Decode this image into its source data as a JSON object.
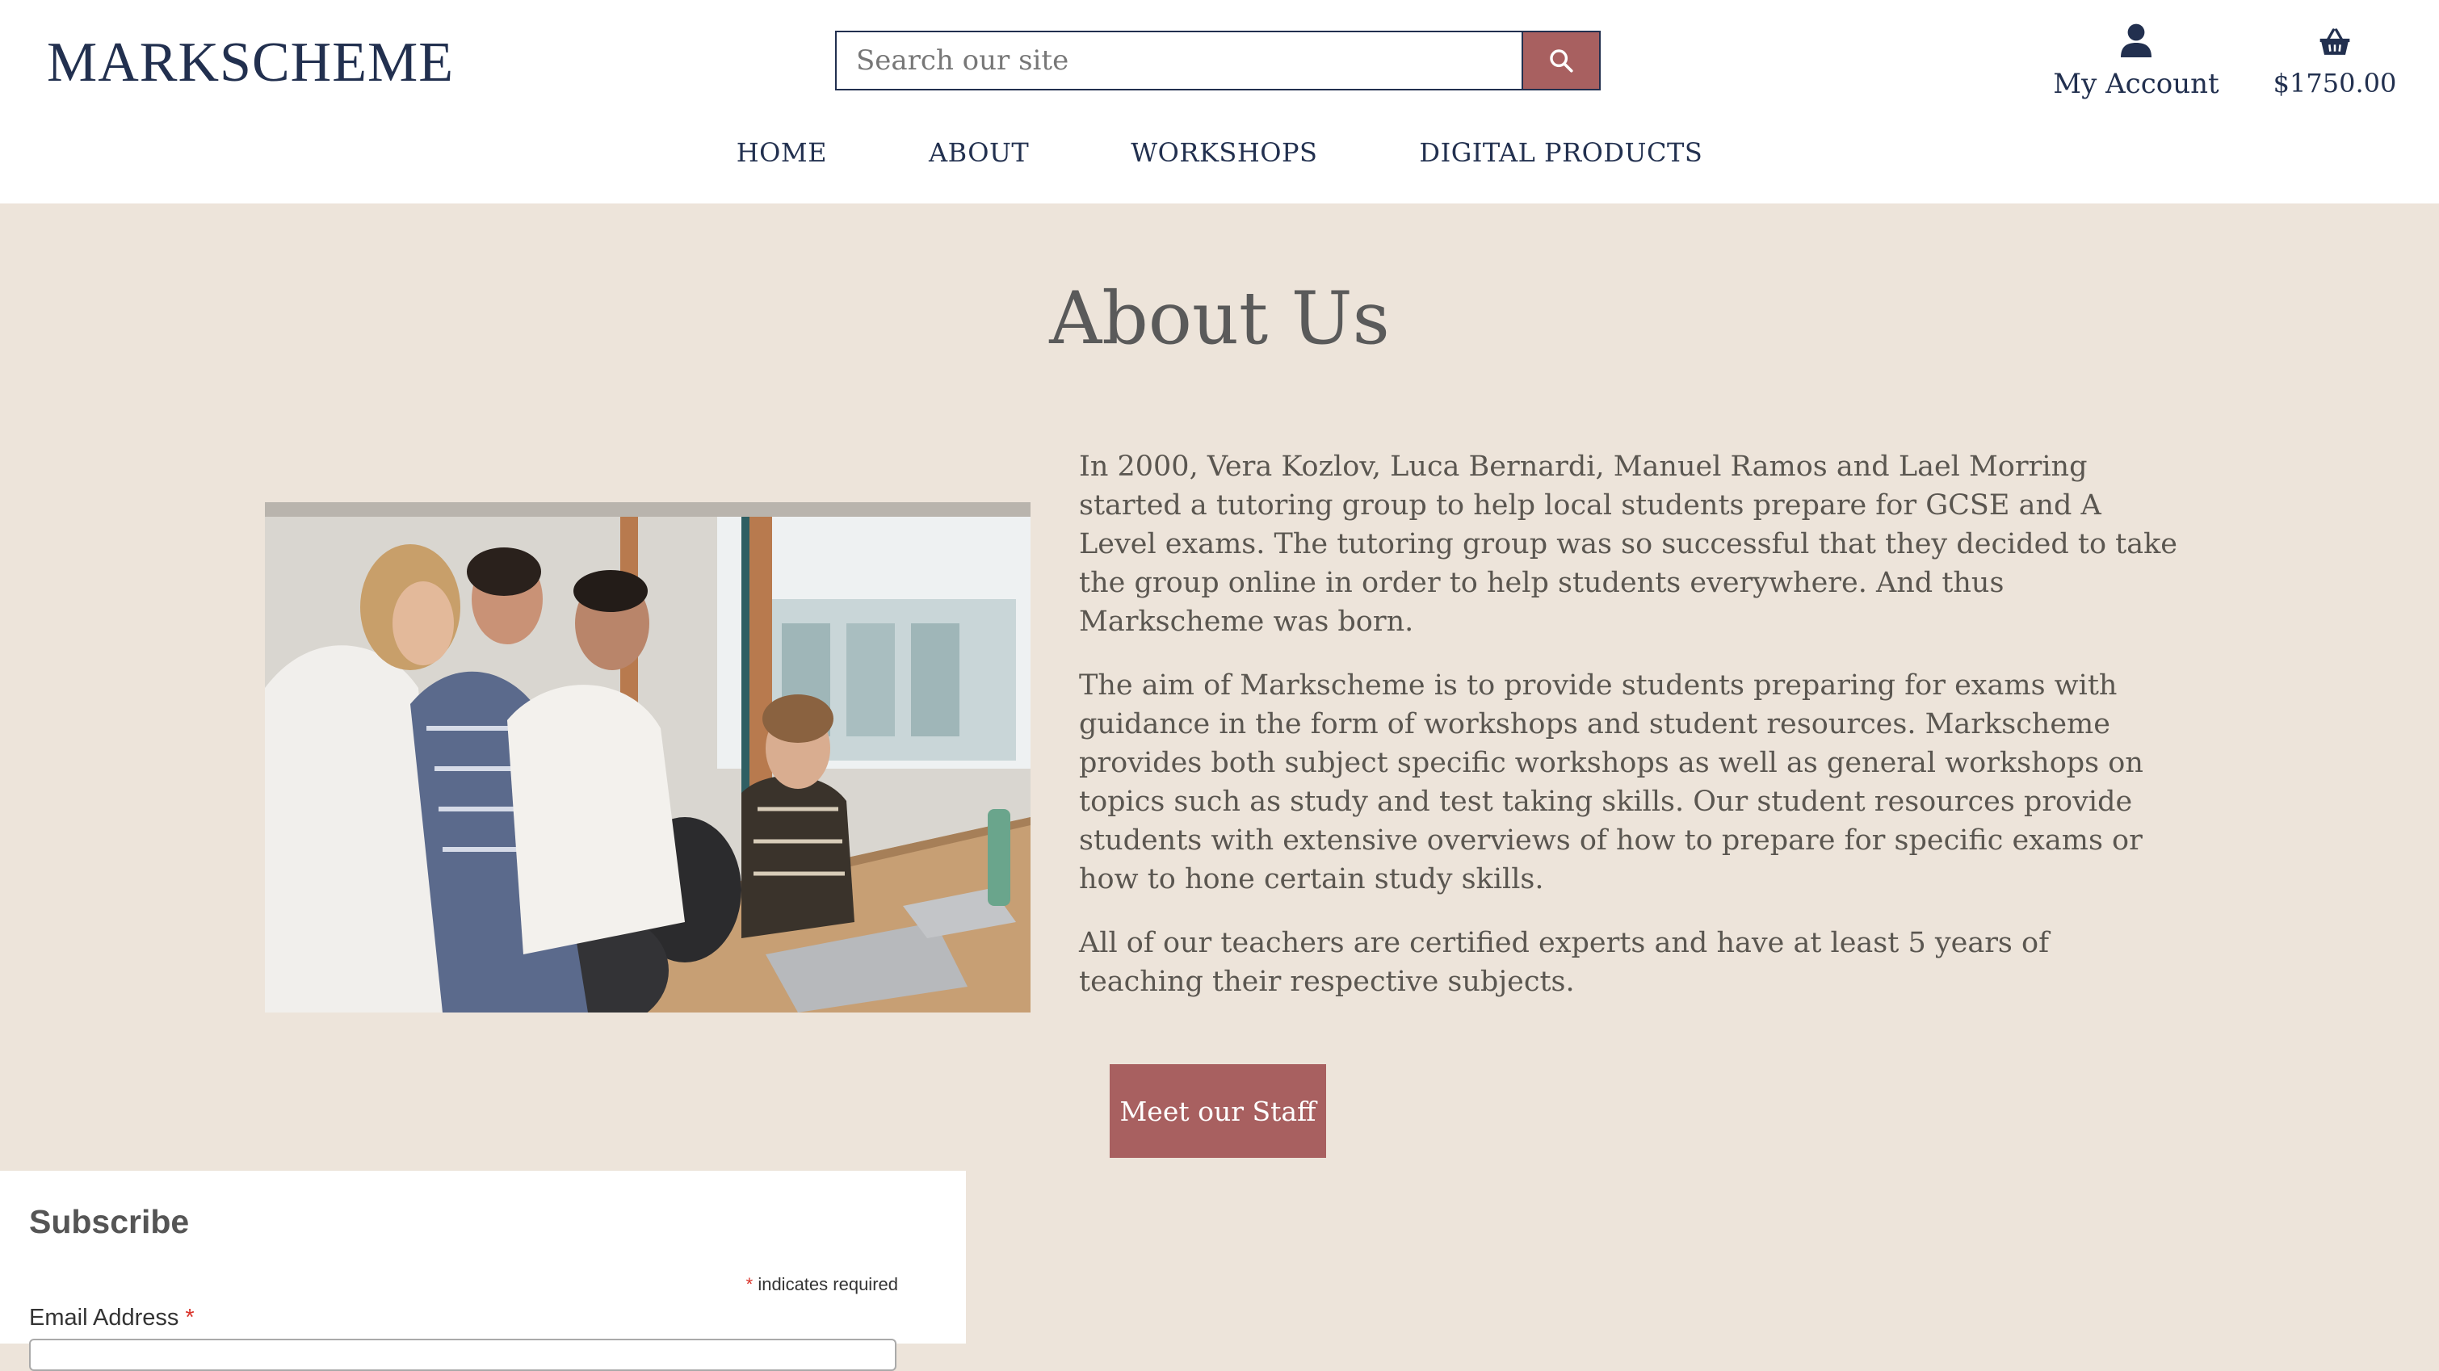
{
  "header": {
    "logo": "MARKSCHEME",
    "search": {
      "placeholder": "Search our site"
    },
    "account_label": "My Account",
    "cart_total": "$1750.00"
  },
  "nav": {
    "items": [
      "HOME",
      "ABOUT",
      "WORKSHOPS",
      "DIGITAL PRODUCTS"
    ]
  },
  "about": {
    "title": "About Us",
    "paragraphs": [
      "In 2000, Vera Kozlov, Luca Bernardi, Manuel Ramos and Lael Morring started a tutoring group to help local students prepare for GCSE and A Level exams. The tutoring group was so successful that they decided to take the group online in order to help students everywhere. And thus Markscheme was born.",
      "The aim of Markscheme is to provide students preparing for exams with guidance in the form of workshops and student resources. Markscheme provides both subject specific workshops as well as general workshops on topics such as study and test taking skills. Our student resources provide students with extensive overviews of how to prepare for specific exams or how to hone certain study skills.",
      "All of our teachers are certified experts and have at least 5 years of teaching their respective subjects."
    ],
    "cta_label": "Meet our Staff"
  },
  "subscribe": {
    "title": "Subscribe",
    "required_note": "indicates required",
    "required_marker": "*",
    "email_label": "Email Address"
  },
  "colors": {
    "brand_navy": "#22304f",
    "accent_rose": "#a86060",
    "page_bg": "#ede4da"
  },
  "icons": [
    "search-icon",
    "user-icon",
    "basket-icon"
  ]
}
